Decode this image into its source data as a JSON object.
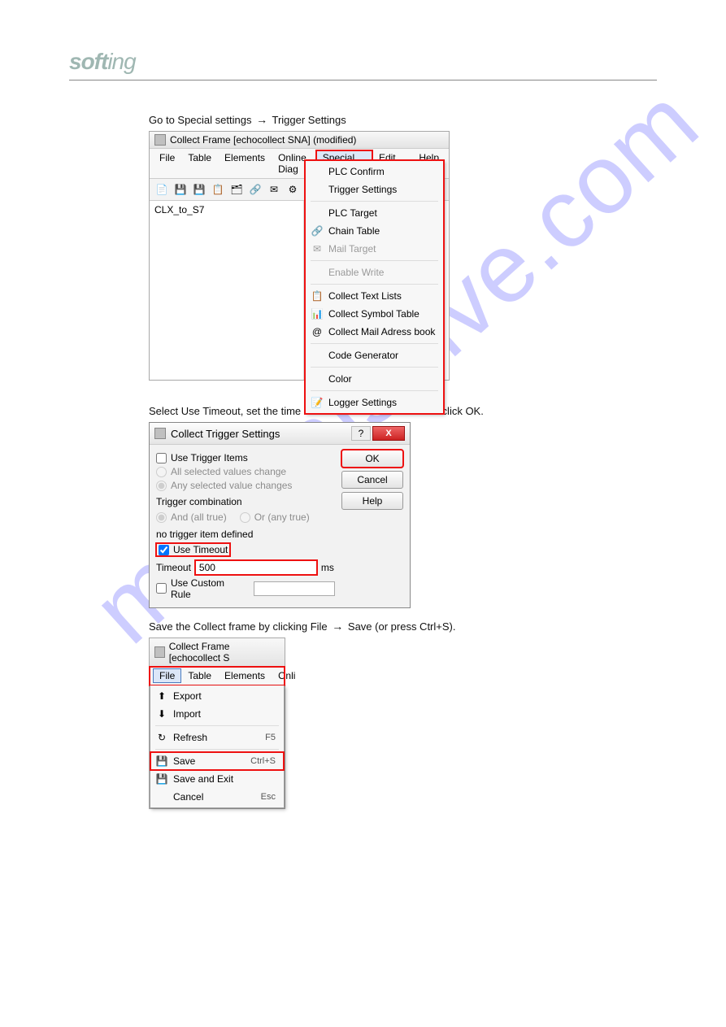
{
  "watermark": "manualshive.com",
  "logo_text": "softing",
  "step1": "Go to Special settings",
  "arrow": "→",
  "step1b": "Trigger Settings",
  "win1": {
    "title": "Collect Frame [echocollect SNA] (modified)",
    "menubar": [
      "File",
      "Table",
      "Elements",
      "Online Diag",
      "Special Settings",
      "Edit Mode",
      "Help"
    ],
    "left_item": "CLX_to_S7",
    "dropdown": [
      {
        "label": "PLC Confirm",
        "icon": "",
        "disabled": false
      },
      {
        "label": "Trigger Settings",
        "icon": "",
        "disabled": false
      },
      {
        "label": "PLC Target",
        "icon": "",
        "disabled": false,
        "sep_before": true
      },
      {
        "label": "Chain Table",
        "icon": "🔗",
        "disabled": false
      },
      {
        "label": "Mail Target",
        "icon": "✉",
        "disabled": true
      },
      {
        "label": "Enable Write",
        "icon": "",
        "disabled": true,
        "sep_before": true
      },
      {
        "label": "Collect Text Lists",
        "icon": "📋",
        "disabled": false,
        "sep_before": true
      },
      {
        "label": "Collect Symbol Table",
        "icon": "📊",
        "disabled": false
      },
      {
        "label": "Collect Mail Adress book",
        "icon": "@",
        "disabled": false
      },
      {
        "label": "Code Generator",
        "icon": "",
        "disabled": false,
        "sep_before": true
      },
      {
        "label": "Color",
        "icon": "",
        "disabled": false,
        "sep_before": true
      },
      {
        "label": "Logger Settings",
        "icon": "📝",
        "disabled": false,
        "sep_before": true
      }
    ]
  },
  "step2": "Select Use Timeout, set the time in ms in the Timeout box and click OK.",
  "dialog": {
    "title": "Collect Trigger Settings",
    "use_trigger_items": "Use Trigger Items",
    "all_selected": "All selected values change",
    "any_selected": "Any selected value changes",
    "trigger_combination": "Trigger combination",
    "and_all": "And (all true)",
    "or_any": "Or (any true)",
    "no_trigger": "no trigger item defined",
    "use_timeout": "Use Timeout",
    "timeout_label": "Timeout",
    "timeout_value": "500",
    "timeout_unit": "ms",
    "use_custom": "Use Custom Rule",
    "ok": "OK",
    "cancel": "Cancel",
    "help": "Help"
  },
  "step3a": "Save the Collect frame by clicking File",
  "step3b": "Save (or press Ctrl+S).",
  "win3": {
    "title": "Collect Frame [echocollect S",
    "menubar": [
      "File",
      "Table",
      "Elements",
      "Onli"
    ],
    "dropdown": [
      {
        "label": "Export",
        "icon": "⬆",
        "shortcut": ""
      },
      {
        "label": "Import",
        "icon": "⬇",
        "shortcut": ""
      },
      {
        "label": "Refresh",
        "icon": "↻",
        "shortcut": "F5",
        "sep_before": true
      },
      {
        "label": "Save",
        "icon": "💾",
        "shortcut": "Ctrl+S",
        "sep_before": true,
        "highlight": true
      },
      {
        "label": "Save and Exit",
        "icon": "💾",
        "shortcut": ""
      },
      {
        "label": "Cancel",
        "icon": "",
        "shortcut": "Esc"
      }
    ]
  }
}
